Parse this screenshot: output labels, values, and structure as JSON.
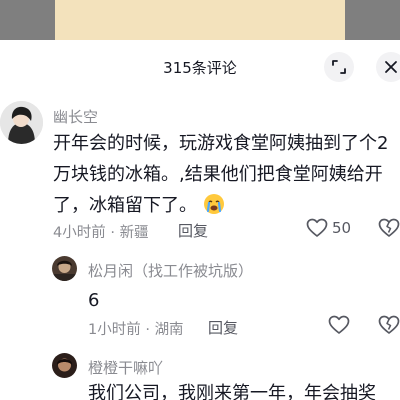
{
  "header": {
    "title": "315条评论"
  },
  "comments": [
    {
      "username": "幽长空",
      "content": "开年会的时候，玩游戏食堂阿姨抽到了个2万块钱的冰箱。,结果他们把食堂阿姨给开了，冰箱留下了。",
      "time": "4小时前",
      "location": "新疆",
      "reply_label": "回复",
      "likes": "50",
      "reply": {
        "username": "松月闲（找工作被坑版）",
        "content": "6",
        "time": "1小时前",
        "location": "湖南",
        "reply_label": "回复"
      }
    },
    {
      "username": "橙橙干嘛吖",
      "content": "我们公司，我刚来第一年，年会抽奖"
    }
  ],
  "icons": [
    "expand-icon",
    "close-icon",
    "heart-icon",
    "dislike-icon",
    "cry-emoji"
  ],
  "colors": {
    "text": "#161823",
    "secondary": "#8a8b91",
    "button_bg": "#f2f2f4"
  }
}
